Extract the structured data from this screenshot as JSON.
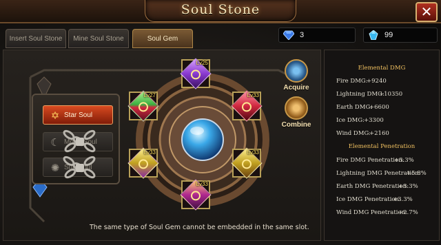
{
  "window": {
    "title": "Soul Stone"
  },
  "tabs": [
    {
      "label": "Insert Soul Stone",
      "active": false
    },
    {
      "label": "Mine Soul Stone",
      "active": false
    },
    {
      "label": "Soul Gem",
      "active": true
    }
  ],
  "currency": {
    "diamond": {
      "icon": "blue-diamond-icon",
      "value": "3"
    },
    "crystal": {
      "icon": "blue-crystal-icon",
      "value": "99"
    }
  },
  "soul_buttons": [
    {
      "label": "Star Soul",
      "icon": "star-icon",
      "state": "active"
    },
    {
      "label": "Moon Soul",
      "icon": "moon-icon",
      "state": "locked"
    },
    {
      "label": "Sun Soul",
      "icon": "sun-icon",
      "state": "locked"
    }
  ],
  "gems": [
    {
      "slot": "top",
      "level": "Lv25",
      "color": "#8a3ad0"
    },
    {
      "slot": "upper-left",
      "level": "Lv27",
      "color": "#3ab040"
    },
    {
      "slot": "upper-right",
      "level": "Lv33",
      "color": "#d02840"
    },
    {
      "slot": "lower-left",
      "level": "Lv33",
      "color": "#c0a020"
    },
    {
      "slot": "lower-right",
      "level": "Lv33",
      "color": "#c0a020"
    },
    {
      "slot": "bottom",
      "level": "Lv33",
      "color": "#b02890"
    }
  ],
  "actions": {
    "acquire": "Acquire",
    "combine": "Combine"
  },
  "notice": "The same type of Soul Gem cannot be embedded in the same slot.",
  "stats": {
    "elemental_dmg_title": "Elemental DMG",
    "elemental_dmg": [
      {
        "label": "Fire DMG:",
        "value": "+9240"
      },
      {
        "label": "Lightning DMG:",
        "value": "+10350"
      },
      {
        "label": "Earth DMG:",
        "value": "+6600"
      },
      {
        "label": "Ice DMG:",
        "value": "+3300"
      },
      {
        "label": "Wind DMG:",
        "value": "+2160"
      }
    ],
    "elemental_pen_title": "Elemental Penetration",
    "elemental_pen": [
      {
        "label": "Fire DMG Penetration:",
        "value": "+3.3%"
      },
      {
        "label": "Lightning DMG Penetration:",
        "value": "+5.8%"
      },
      {
        "label": "Earth DMG Penetration:",
        "value": "+3.3%"
      },
      {
        "label": "Ice DMG Penetration:",
        "value": "+3.3%"
      },
      {
        "label": "Wind DMG Penetration:",
        "value": "+2.7%"
      }
    ]
  },
  "colors": {
    "accent": "#d84a20",
    "gold": "#f0c060",
    "frame": "#b8a058"
  }
}
